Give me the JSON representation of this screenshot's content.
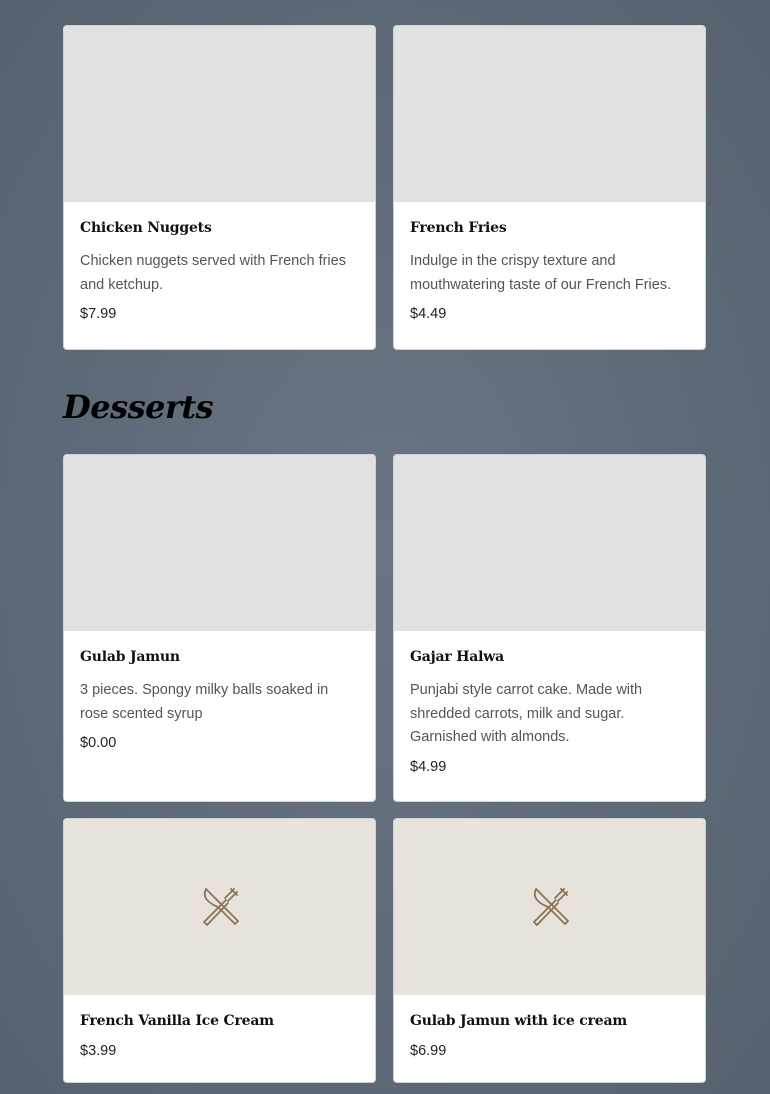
{
  "sections": [
    {
      "items": [
        {
          "name": "Chicken Nuggets",
          "description": "Chicken nuggets served with French fries and ketchup.",
          "price": "$7.99"
        },
        {
          "name": "French Fries",
          "description": "Indulge in the crispy texture and mouthwatering taste of our French Fries.",
          "price": "$4.49"
        }
      ]
    },
    {
      "title": "Desserts",
      "items": [
        {
          "name": "Gulab Jamun",
          "description": "3 pieces. Spongy milky balls soaked in rose scented syrup",
          "price": "$0.00"
        },
        {
          "name": "Gajar Halwa",
          "description": "Punjabi style carrot cake. Made with shredded carrots, milk and sugar. Garnished with almonds.",
          "price": "$4.99"
        },
        {
          "name": "French Vanilla Ice Cream",
          "price": "$3.99",
          "image": "fork-knife-icon"
        },
        {
          "name": "Gulab Jamun with ice cream",
          "price": "$6.99",
          "image": "fork-knife-icon"
        }
      ]
    }
  ],
  "colors": {
    "placeholder_bg": "#e8e2dc",
    "icon": "#8b7457",
    "image_bg": "#e1e1e1"
  }
}
